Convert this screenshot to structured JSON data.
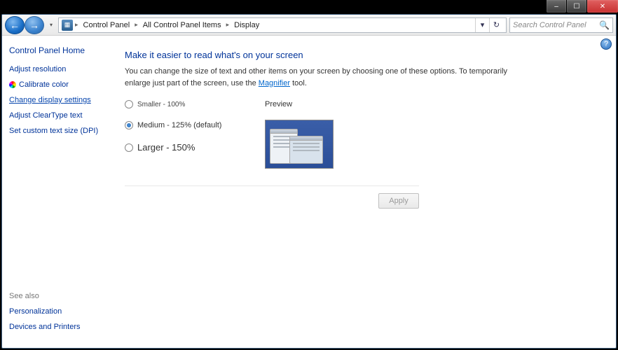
{
  "titlebar": {
    "min": "–",
    "max": "☐",
    "close": "✕"
  },
  "nav": {
    "back": "←",
    "fwd": "→",
    "drop": "▾",
    "crumbs": [
      "Control Panel",
      "All Control Panel Items",
      "Display"
    ],
    "refresh": "↻",
    "chev": "▾",
    "search_placeholder": "Search Control Panel"
  },
  "sidebar": {
    "home": "Control Panel Home",
    "links": [
      {
        "label": "Adjust resolution",
        "active": false,
        "icon": ""
      },
      {
        "label": "Calibrate color",
        "active": false,
        "icon": "cal"
      },
      {
        "label": "Change display settings",
        "active": true,
        "icon": ""
      },
      {
        "label": "Adjust ClearType text",
        "active": false,
        "icon": ""
      },
      {
        "label": "Set custom text size (DPI)",
        "active": false,
        "icon": ""
      }
    ],
    "seealso": "See also",
    "seealso_links": [
      "Personalization",
      "Devices and Printers"
    ]
  },
  "main": {
    "heading": "Make it easier to read what's on your screen",
    "desc1": "You can change the size of text and other items on your screen by choosing one of these options. To temporarily enlarge just part of the screen, use the ",
    "magnifier": "Magnifier",
    "desc2": " tool.",
    "options": [
      {
        "label": "Smaller - 100%",
        "selected": false,
        "cls": "sm"
      },
      {
        "label": "Medium - 125% (default)",
        "selected": true,
        "cls": ""
      },
      {
        "label": "Larger - 150%",
        "selected": false,
        "cls": "lg"
      }
    ],
    "preview_label": "Preview",
    "apply": "Apply",
    "help": "?"
  }
}
